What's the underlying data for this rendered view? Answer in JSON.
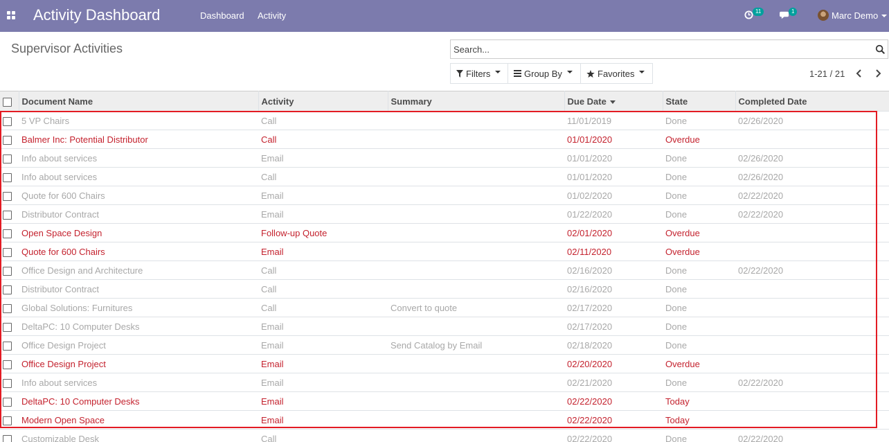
{
  "navbar": {
    "app_title": "Activity Dashboard",
    "menu": [
      {
        "label": "Dashboard"
      },
      {
        "label": "Activity"
      }
    ],
    "activity_count": "11",
    "message_count": "1",
    "user_name": "Marc Demo",
    "color": "#7c7bad"
  },
  "control_panel": {
    "title": "Supervisor Activities",
    "search_placeholder": "Search...",
    "filters_label": "Filters",
    "group_by_label": "Group By",
    "favorites_label": "Favorites",
    "pager_value": "1-21 / 21"
  },
  "table": {
    "columns": [
      "Document Name",
      "Activity",
      "Summary",
      "Due Date",
      "State",
      "Completed Date"
    ],
    "sorted_column": "Due Date",
    "rows": [
      {
        "doc": "5 VP Chairs",
        "activity": "Call",
        "summary": "",
        "due": "11/01/2019",
        "state": "Done",
        "completed": "02/26/2020",
        "style": "muted"
      },
      {
        "doc": "Balmer Inc: Potential Distributor",
        "activity": "Call",
        "summary": "",
        "due": "01/01/2020",
        "state": "Overdue",
        "completed": "",
        "style": "danger"
      },
      {
        "doc": "Info about services",
        "activity": "Email",
        "summary": "",
        "due": "01/01/2020",
        "state": "Done",
        "completed": "02/26/2020",
        "style": "muted"
      },
      {
        "doc": "Info about services",
        "activity": "Call",
        "summary": "",
        "due": "01/01/2020",
        "state": "Done",
        "completed": "02/26/2020",
        "style": "muted"
      },
      {
        "doc": "Quote for 600 Chairs",
        "activity": "Email",
        "summary": "",
        "due": "01/02/2020",
        "state": "Done",
        "completed": "02/22/2020",
        "style": "muted"
      },
      {
        "doc": "Distributor Contract",
        "activity": "Email",
        "summary": "",
        "due": "01/22/2020",
        "state": "Done",
        "completed": "02/22/2020",
        "style": "muted"
      },
      {
        "doc": "Open Space Design",
        "activity": "Follow-up Quote",
        "summary": "",
        "due": "02/01/2020",
        "state": "Overdue",
        "completed": "",
        "style": "danger"
      },
      {
        "doc": "Quote for 600 Chairs",
        "activity": "Email",
        "summary": "",
        "due": "02/11/2020",
        "state": "Overdue",
        "completed": "",
        "style": "danger"
      },
      {
        "doc": "Office Design and Architecture",
        "activity": "Call",
        "summary": "",
        "due": "02/16/2020",
        "state": "Done",
        "completed": "02/22/2020",
        "style": "muted"
      },
      {
        "doc": "Distributor Contract",
        "activity": "Call",
        "summary": "",
        "due": "02/16/2020",
        "state": "Done",
        "completed": "",
        "style": "muted"
      },
      {
        "doc": "Global Solutions: Furnitures",
        "activity": "Call",
        "summary": "Convert to quote",
        "due": "02/17/2020",
        "state": "Done",
        "completed": "",
        "style": "muted"
      },
      {
        "doc": "DeltaPC: 10 Computer Desks",
        "activity": "Email",
        "summary": "",
        "due": "02/17/2020",
        "state": "Done",
        "completed": "",
        "style": "muted"
      },
      {
        "doc": "Office Design Project",
        "activity": "Email",
        "summary": "Send Catalog by Email",
        "due": "02/18/2020",
        "state": "Done",
        "completed": "",
        "style": "muted"
      },
      {
        "doc": "Office Design Project",
        "activity": "Email",
        "summary": "",
        "due": "02/20/2020",
        "state": "Overdue",
        "completed": "",
        "style": "danger"
      },
      {
        "doc": "Info about services",
        "activity": "Email",
        "summary": "",
        "due": "02/21/2020",
        "state": "Done",
        "completed": "02/22/2020",
        "style": "muted"
      },
      {
        "doc": "DeltaPC: 10 Computer Desks",
        "activity": "Email",
        "summary": "",
        "due": "02/22/2020",
        "state": "Today",
        "completed": "",
        "style": "danger"
      },
      {
        "doc": "Modern Open Space",
        "activity": "Email",
        "summary": "",
        "due": "02/22/2020",
        "state": "Today",
        "completed": "",
        "style": "danger"
      },
      {
        "doc": "Customizable Desk",
        "activity": "Call",
        "summary": "",
        "due": "02/22/2020",
        "state": "Done",
        "completed": "02/22/2020",
        "style": "muted"
      }
    ]
  },
  "colors": {
    "danger_text": "#c4222e",
    "muted_text": "#a8a8a8",
    "highlight_border": "#e31b23"
  }
}
